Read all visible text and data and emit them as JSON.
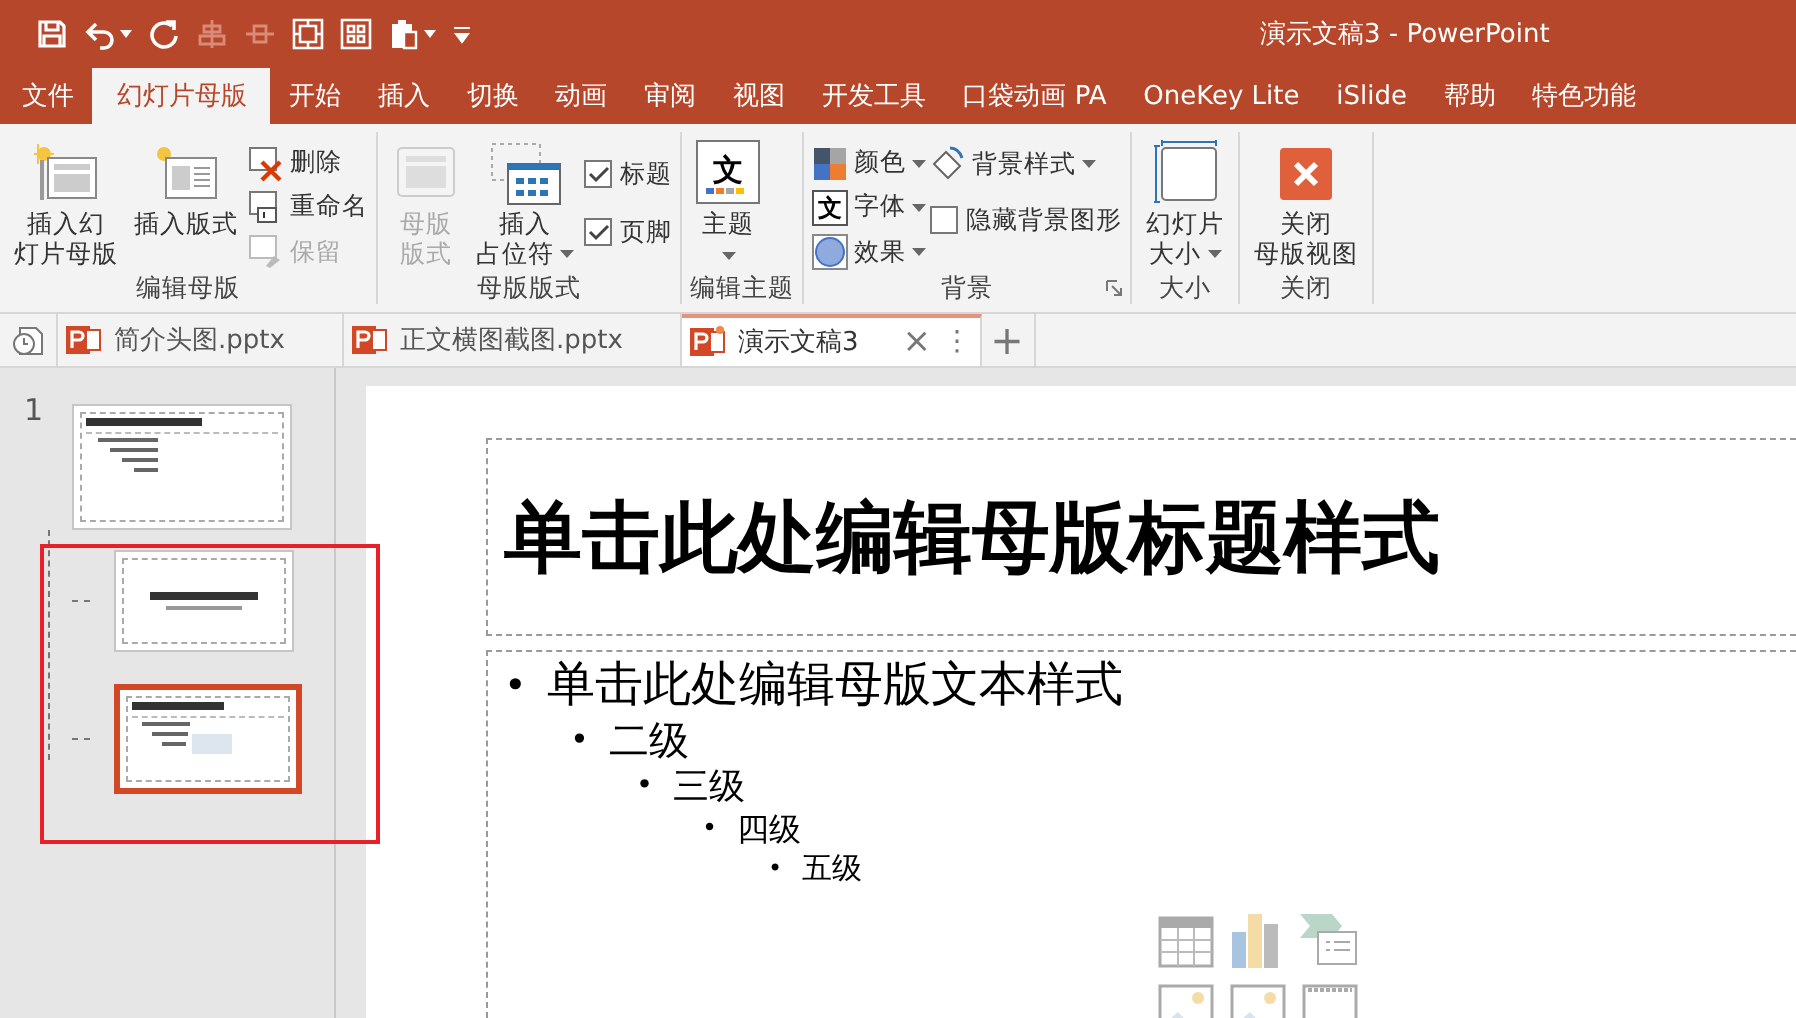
{
  "window": {
    "title": "演示文稿3  -  PowerPoint"
  },
  "quick_access": [
    {
      "kind": "save",
      "disabled": false,
      "dropdown": false
    },
    {
      "kind": "undo",
      "disabled": false,
      "dropdown": true
    },
    {
      "kind": "redo",
      "disabled": false,
      "dropdown": false
    },
    {
      "kind": "align",
      "disabled": true,
      "dropdown": false
    },
    {
      "kind": "distribute",
      "disabled": true,
      "dropdown": false
    },
    {
      "kind": "fit",
      "disabled": false,
      "dropdown": false
    },
    {
      "kind": "grid",
      "disabled": false,
      "dropdown": false
    },
    {
      "kind": "paste",
      "disabled": false,
      "dropdown": true
    },
    {
      "kind": "customize",
      "disabled": false,
      "dropdown": false
    }
  ],
  "ribbon_tabs": [
    {
      "label": "文件",
      "selected": false
    },
    {
      "label": "幻灯片母版",
      "selected": true
    },
    {
      "label": "开始",
      "selected": false
    },
    {
      "label": "插入",
      "selected": false
    },
    {
      "label": "切换",
      "selected": false
    },
    {
      "label": "动画",
      "selected": false
    },
    {
      "label": "审阅",
      "selected": false
    },
    {
      "label": "视图",
      "selected": false
    },
    {
      "label": "开发工具",
      "selected": false
    },
    {
      "label": "口袋动画 PA",
      "selected": false
    },
    {
      "label": "OneKey Lite",
      "selected": false
    },
    {
      "label": "iSlide",
      "selected": false
    },
    {
      "label": "帮助",
      "selected": false
    },
    {
      "label": "特色功能",
      "selected": false
    }
  ],
  "ribbon": {
    "groups": [
      {
        "label": "编辑母版",
        "launcher": false,
        "columns": [
          [
            {
              "kind": "large",
              "lines": [
                "插入幻",
                "灯片母版"
              ],
              "disabled": false,
              "dropdown": false
            }
          ],
          [
            {
              "kind": "large",
              "lines": [
                "插入版式"
              ],
              "disabled": false,
              "dropdown": false
            }
          ],
          [
            {
              "kind": "small",
              "label": "删除",
              "disabled": false,
              "dropdown": false
            },
            {
              "kind": "small",
              "label": "重命名",
              "disabled": false,
              "dropdown": false
            },
            {
              "kind": "small",
              "label": "保留",
              "disabled": true,
              "dropdown": false
            }
          ]
        ]
      },
      {
        "label": "母版版式",
        "launcher": false,
        "columns": [
          [
            {
              "kind": "large",
              "lines": [
                "母版",
                "版式"
              ],
              "disabled": true,
              "dropdown": false
            }
          ],
          [
            {
              "kind": "large",
              "lines": [
                "插入",
                "占位符"
              ],
              "disabled": false,
              "dropdown": true
            }
          ],
          [
            {
              "kind": "check",
              "label": "标题",
              "checked": true
            },
            {
              "kind": "check",
              "label": "页脚",
              "checked": true
            }
          ]
        ]
      },
      {
        "label": "编辑主题",
        "launcher": false,
        "columns": [
          [
            {
              "kind": "large",
              "lines": [
                "主题"
              ],
              "glyph": "文",
              "disabled": false,
              "dropdown": true
            }
          ]
        ]
      },
      {
        "label": "背景",
        "launcher": true,
        "columns": [
          [
            {
              "kind": "small",
              "label": "颜色",
              "disabled": false,
              "dropdown": true
            },
            {
              "kind": "small",
              "label": "字体",
              "glyph": "文",
              "disabled": false,
              "dropdown": true
            },
            {
              "kind": "small",
              "label": "效果",
              "disabled": false,
              "dropdown": true
            }
          ],
          [
            {
              "kind": "small",
              "label": "背景样式",
              "disabled": false,
              "dropdown": true
            },
            {
              "kind": "check",
              "label": "隐藏背景图形",
              "checked": false
            }
          ]
        ]
      },
      {
        "label": "大小",
        "launcher": false,
        "columns": [
          [
            {
              "kind": "large",
              "lines": [
                "幻灯片",
                "大小"
              ],
              "disabled": false,
              "dropdown": true
            }
          ]
        ]
      },
      {
        "label": "关闭",
        "launcher": false,
        "columns": [
          [
            {
              "kind": "large",
              "lines": [
                "关闭",
                "母版视图"
              ],
              "disabled": false,
              "dropdown": false
            }
          ]
        ]
      }
    ]
  },
  "document_tabs": {
    "tabs": [
      {
        "label": "简介头图.pptx",
        "selected": false,
        "modified": false
      },
      {
        "label": "正文横图截图.pptx",
        "selected": false,
        "modified": false
      },
      {
        "label": "演示文稿3",
        "selected": true,
        "modified": true
      }
    ],
    "close": "×",
    "menu": "⋮",
    "new_tab": "+"
  },
  "thumbnails": {
    "number": "1",
    "master": {
      "kind": "master",
      "selected": false
    },
    "children": [
      {
        "kind": "title",
        "selected": false
      },
      {
        "kind": "content",
        "selected": true
      }
    ]
  },
  "annotation": {
    "kind": "rectangle"
  },
  "slide": {
    "title": "单击此处编辑母版标题样式",
    "body": [
      {
        "bullet": "•",
        "text": "单击此处编辑母版文本样式",
        "children": [
          {
            "bullet": "•",
            "text": "二级",
            "children": [
              {
                "bullet": "•",
                "text": "三级",
                "children": [
                  {
                    "bullet": "•",
                    "text": "四级",
                    "children": [
                      {
                        "bullet": "•",
                        "text": "五级"
                      }
                    ]
                  }
                ]
              }
            ]
          }
        ]
      }
    ]
  }
}
